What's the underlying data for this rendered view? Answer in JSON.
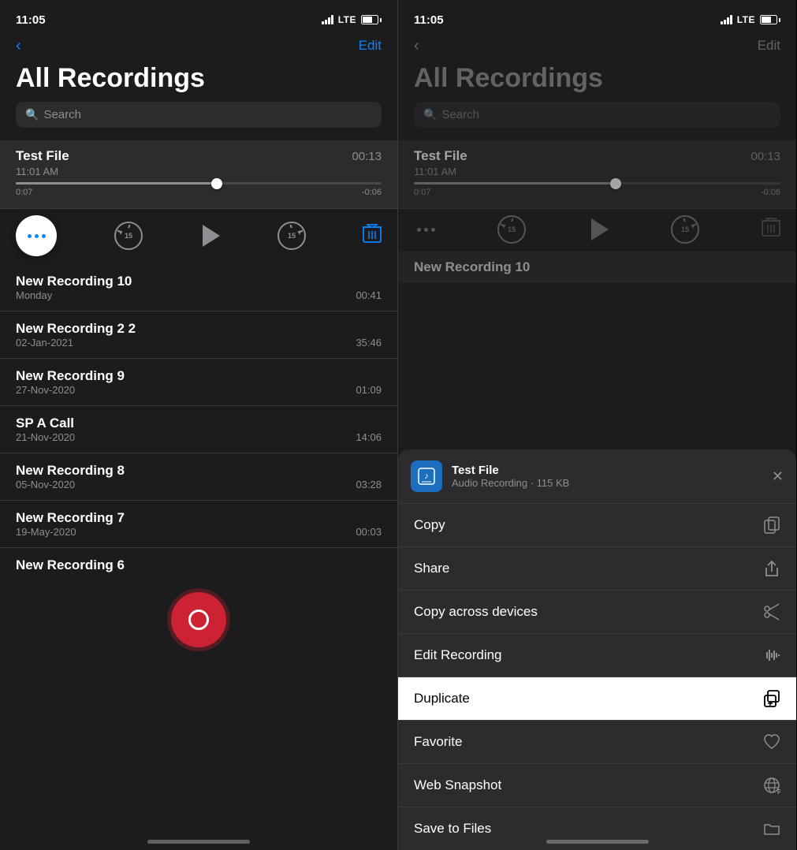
{
  "statusBar": {
    "time": "11:05",
    "lte": "LTE"
  },
  "nav": {
    "backLabel": "",
    "editLabel": "Edit"
  },
  "pageTitle": "All Recordings",
  "searchPlaceholder": "Search",
  "activeRecording": {
    "title": "Test File",
    "date": "11:01 AM",
    "duration": "00:13",
    "progressStart": "0:07",
    "progressEnd": "-0:06",
    "progressPercent": 55
  },
  "recordings": [
    {
      "title": "New Recording 10",
      "date": "Monday",
      "duration": "00:41"
    },
    {
      "title": "New Recording 2 2",
      "date": "02-Jan-2021",
      "duration": "35:46"
    },
    {
      "title": "New Recording 9",
      "date": "27-Nov-2020",
      "duration": "01:09"
    },
    {
      "title": "SP A Call",
      "date": "21-Nov-2020",
      "duration": "14:06"
    },
    {
      "title": "New Recording 8",
      "date": "05-Nov-2020",
      "duration": "03:28"
    },
    {
      "title": "New Recording 7",
      "date": "19-May-2020",
      "duration": "00:03"
    },
    {
      "title": "New Recording 6",
      "date": "",
      "duration": ""
    }
  ],
  "rightPanel": {
    "fileCard": {
      "name": "Test File",
      "meta": "Audio Recording · 115 KB"
    },
    "menuItems": [
      {
        "label": "Copy",
        "icon": "copy"
      },
      {
        "label": "Share",
        "icon": "share"
      },
      {
        "label": "Copy across devices",
        "icon": "scissors"
      },
      {
        "label": "Edit Recording",
        "icon": "waveform"
      },
      {
        "label": "Duplicate",
        "icon": "duplicate",
        "highlighted": true
      },
      {
        "label": "Favorite",
        "icon": "heart"
      },
      {
        "label": "Web Snapshot",
        "icon": "web"
      },
      {
        "label": "Save to Files",
        "icon": "folder"
      }
    ]
  }
}
